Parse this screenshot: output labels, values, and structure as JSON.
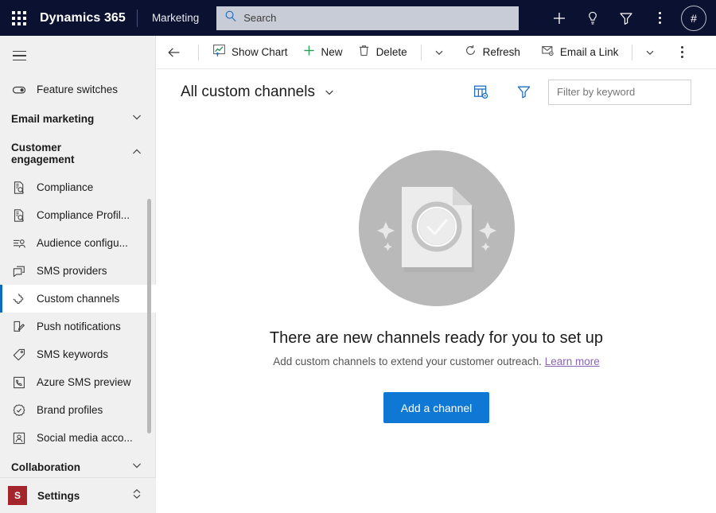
{
  "header": {
    "waffle_icon": "app-launcher-icon",
    "brand": "Dynamics 365",
    "app_name": "Marketing",
    "search": {
      "icon": "search-icon",
      "placeholder": "Search",
      "value": ""
    },
    "actions": [
      {
        "name": "quick-create-button",
        "icon": "plus-icon"
      },
      {
        "name": "assistant-button",
        "icon": "lightbulb-icon"
      },
      {
        "name": "filter-button",
        "icon": "funnel-icon"
      },
      {
        "name": "more-button",
        "icon": "more-vertical-icon"
      }
    ],
    "avatar": {
      "name": "user-avatar",
      "initials": "#"
    }
  },
  "sidebar": {
    "menu_icon": "hamburger-icon",
    "top_items": [
      {
        "label": "Feature switches",
        "icon": "toggle-icon"
      }
    ],
    "groups": [
      {
        "label": "Email marketing",
        "expanded": false,
        "chevron": "chevron-down-icon"
      },
      {
        "label": "Customer engagement",
        "expanded": true,
        "chevron": "chevron-up-icon"
      }
    ],
    "items": [
      {
        "label": "Compliance",
        "icon": "document-search-icon",
        "selected": false
      },
      {
        "label": "Compliance Profil...",
        "icon": "document-search-icon",
        "selected": false
      },
      {
        "label": "Audience configu...",
        "icon": "audience-icon",
        "selected": false
      },
      {
        "label": "SMS providers",
        "icon": "chat-bubble-icon",
        "selected": false
      },
      {
        "label": "Custom channels",
        "icon": "puzzle-icon",
        "selected": true
      },
      {
        "label": "Push notifications",
        "icon": "push-notification-icon",
        "selected": false
      },
      {
        "label": "SMS keywords",
        "icon": "tag-icon",
        "selected": false
      },
      {
        "label": "Azure SMS preview",
        "icon": "phone-device-icon",
        "selected": false
      },
      {
        "label": "Brand profiles",
        "icon": "badge-check-icon",
        "selected": false
      },
      {
        "label": "Social media acco...",
        "icon": "person-frame-icon",
        "selected": false
      }
    ],
    "bottom_group": {
      "label": "Collaboration",
      "chevron": "chevron-down-icon"
    },
    "area_switcher": {
      "badge": "S",
      "label": "Settings",
      "icon": "updown-chevron-icon"
    }
  },
  "commandbar": {
    "back": {
      "name": "back-button",
      "icon": "arrow-left-icon"
    },
    "buttons": [
      {
        "label": "Show Chart",
        "icon": "chart-icon"
      },
      {
        "label": "New",
        "icon": "plus-icon"
      },
      {
        "label": "Delete",
        "icon": "trash-icon"
      },
      {
        "label": "Refresh",
        "icon": "refresh-icon"
      },
      {
        "label": "Email a Link",
        "icon": "email-link-icon"
      }
    ],
    "overflow_icon": "more-vertical-icon"
  },
  "view": {
    "title": "All custom channels",
    "title_caret_icon": "chevron-down-icon",
    "edit_columns_icon": "edit-columns-icon",
    "edit_filters_icon": "edit-filters-icon",
    "filter": {
      "placeholder": "Filter by keyword",
      "value": ""
    }
  },
  "empty_state": {
    "illustration": "document-check-circle-illustration",
    "title": "There are new channels ready for you to set up",
    "subtitle": "Add custom channels to extend your customer outreach.",
    "link": "Learn more",
    "button": "Add a channel"
  },
  "colors": {
    "header_bg": "#0b1130",
    "accent_blue": "#0f78d4",
    "selected_bar": "#0f6cbd",
    "link_purple": "#8764b8",
    "settings_badge": "#a4262c",
    "sidebar_bg": "#f0f0f0"
  }
}
